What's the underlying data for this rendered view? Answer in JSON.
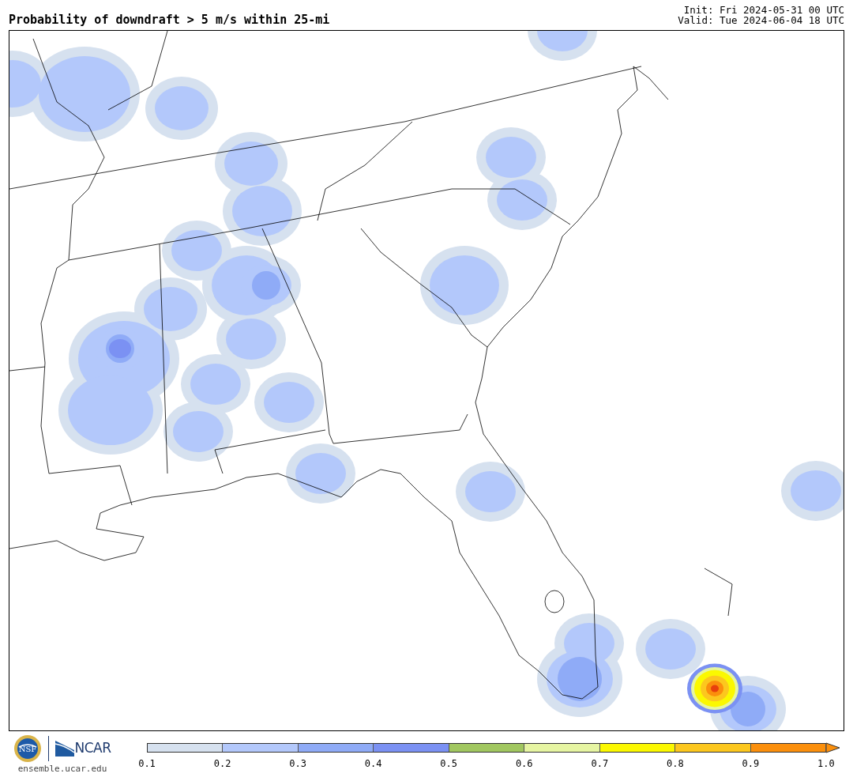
{
  "title": "Probability of downdraft > 5 m/s within 25-mi",
  "init": "Init: Fri 2024-05-31 00 UTC",
  "valid": "Valid: Tue 2024-06-04 18 UTC",
  "logo": {
    "org1": "NSF",
    "org2": "NCAR",
    "url": "ensemble.ucar.edu"
  },
  "legend": {
    "bins": [
      {
        "color": "#d6e1ef"
      },
      {
        "color": "#b3c8fb"
      },
      {
        "color": "#8fabf7"
      },
      {
        "color": "#7b91f3"
      },
      {
        "color": "#a1c760"
      },
      {
        "color": "#e6f5a2"
      },
      {
        "color": "#fbf800"
      },
      {
        "color": "#fcc71e"
      },
      {
        "color": "#fb8f0c"
      }
    ],
    "ticks": [
      "0.1",
      "0.2",
      "0.3",
      "0.4",
      "0.5",
      "0.6",
      "0.7",
      "0.8",
      "0.9",
      "1.0"
    ]
  }
}
